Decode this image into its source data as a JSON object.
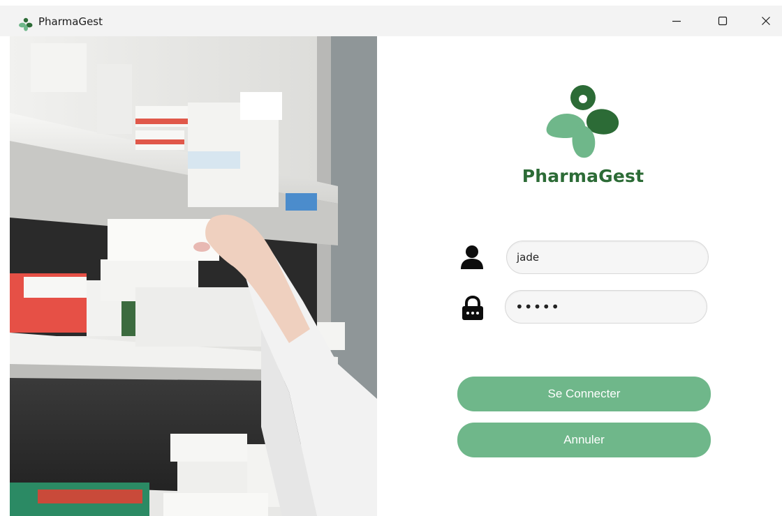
{
  "window": {
    "title": "PharmaGest",
    "controls": {
      "minimize_icon": "minimize-icon",
      "maximize_icon": "maximize-icon",
      "close_icon": "close-icon"
    }
  },
  "branding": {
    "name": "PharmaGest",
    "logo_icon": "pharmagest-logo",
    "colors": {
      "primary_dark": "#2c6b36",
      "primary_light": "#6fb78a"
    }
  },
  "login_form": {
    "username": {
      "icon": "user-icon",
      "value": "jade"
    },
    "password": {
      "icon": "lock-icon",
      "value": "•••••"
    },
    "submit_label": "Se Connecter",
    "cancel_label": "Annuler"
  },
  "hero_image": {
    "description_icon": "pharmacy-shelf-photo"
  }
}
